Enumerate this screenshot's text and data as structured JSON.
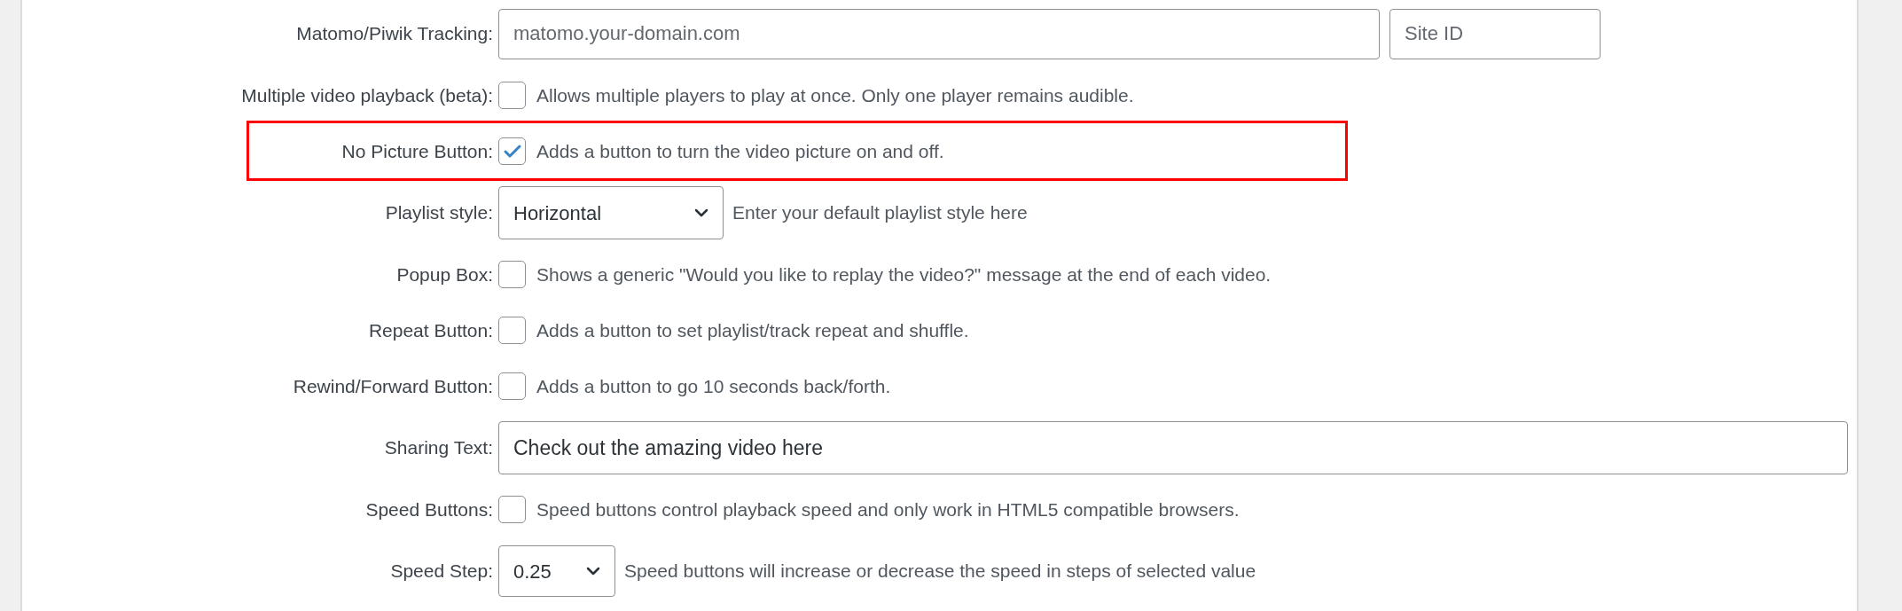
{
  "settings": [
    {
      "kind": "text_pair",
      "label": "Matomo/Piwik Tracking:",
      "placeholder": "matomo.your-domain.com",
      "second_placeholder": "Site ID"
    },
    {
      "kind": "checkbox",
      "label": "Multiple video playback (beta):",
      "checked": false,
      "highlighted": false,
      "description": "Allows multiple players to play at once. Only one player remains audible."
    },
    {
      "kind": "checkbox",
      "label": "No Picture Button:",
      "checked": true,
      "highlighted": true,
      "description": "Adds a button to turn the video picture on and off."
    },
    {
      "kind": "select",
      "label": "Playlist style:",
      "value": "Horizontal",
      "description": "Enter your default playlist style here"
    },
    {
      "kind": "checkbox",
      "label": "Popup Box:",
      "checked": false,
      "highlighted": false,
      "description": "Shows a generic \"Would you like to replay the video?\" message at the end of each video."
    },
    {
      "kind": "checkbox",
      "label": "Repeat Button:",
      "checked": false,
      "highlighted": false,
      "description": "Adds a button to set playlist/track repeat and shuffle."
    },
    {
      "kind": "checkbox",
      "label": "Rewind/Forward Button:",
      "checked": false,
      "highlighted": false,
      "description": "Adds a button to go 10 seconds back/forth."
    },
    {
      "kind": "text",
      "label": "Sharing Text:",
      "value": "Check out the amazing video here"
    },
    {
      "kind": "checkbox",
      "label": "Speed Buttons:",
      "checked": false,
      "highlighted": false,
      "description": "Speed buttons control playback speed and only work in HTML5 compatible browsers."
    },
    {
      "kind": "small_select",
      "label": "Speed Step:",
      "value": "0.25",
      "description": "Speed buttons will increase or decrease the speed in steps of selected value"
    }
  ]
}
